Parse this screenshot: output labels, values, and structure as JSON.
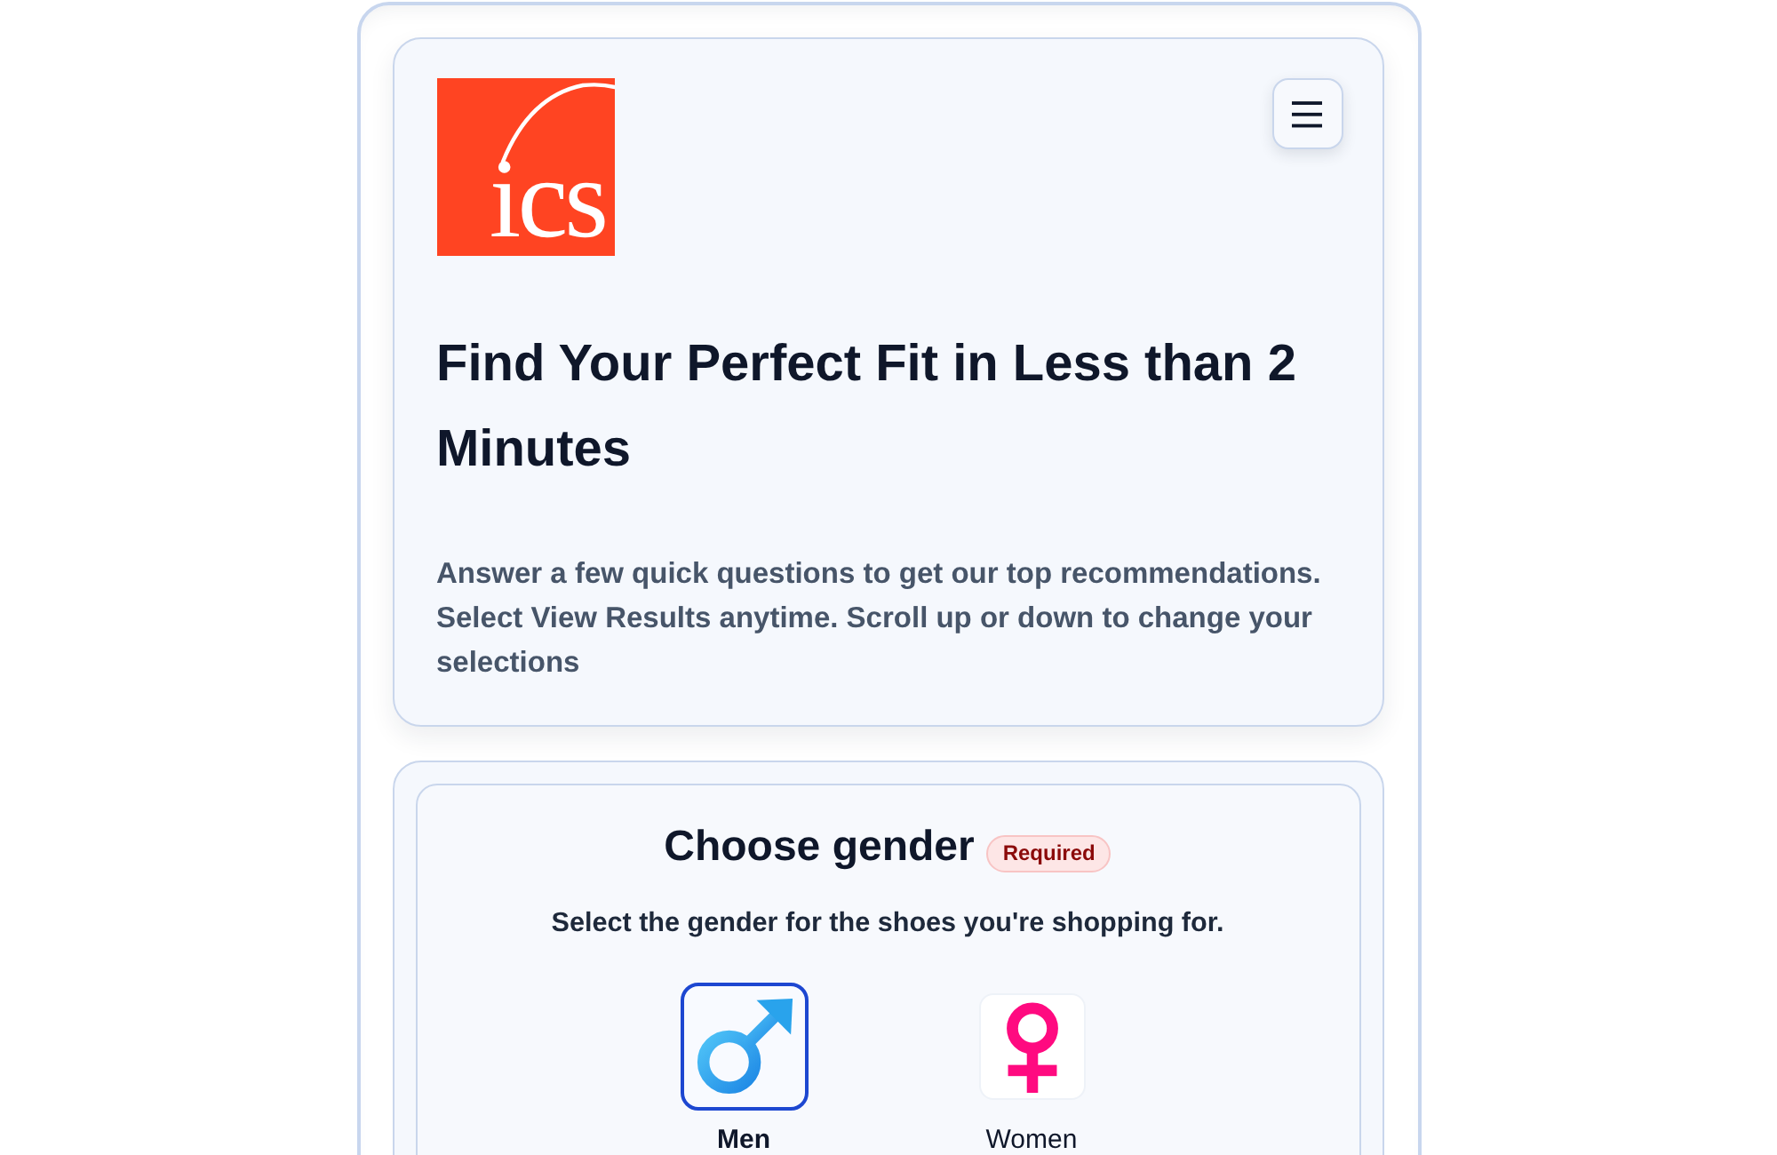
{
  "header": {
    "logo_text": "ics"
  },
  "intro": {
    "title": "Find Your Perfect Fit in Less than 2 Minutes",
    "description": "Answer a few quick questions to get our top recommendations. Select View Results anytime. Scroll up or down to change your selections"
  },
  "question": {
    "title": "Choose gender",
    "badge": "Required",
    "subtitle": "Select the gender for the shoes you're shopping for.",
    "options": [
      {
        "label": "Men",
        "kind": "male",
        "selected": true
      },
      {
        "label": "Women",
        "kind": "female",
        "selected": false
      }
    ]
  }
}
